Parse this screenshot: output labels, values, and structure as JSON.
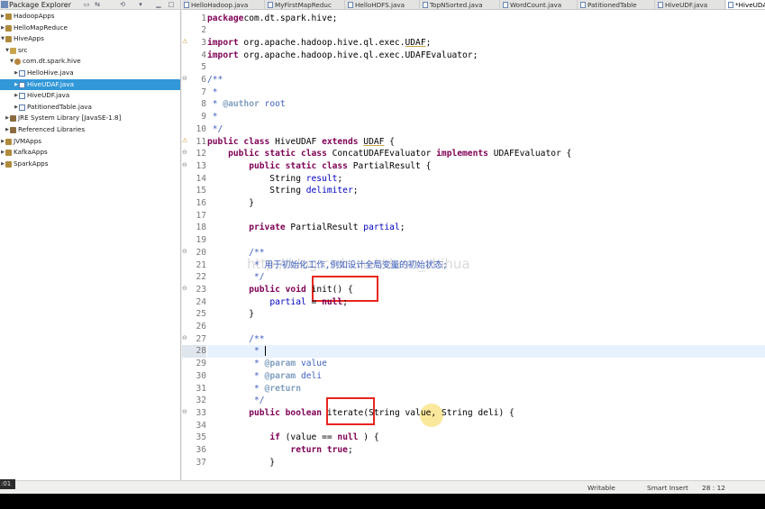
{
  "explorer": {
    "title": "Package Explorer",
    "toolbar_icons": [
      "minimize-icon",
      "maximize-icon",
      "view-menu-icon",
      "collapse-all-icon",
      "link-editor-icon"
    ],
    "items": [
      {
        "label": "HadoopApps",
        "level": 0,
        "expanded": false,
        "icon": "project"
      },
      {
        "label": "HelloMapReduce",
        "level": 0,
        "expanded": false,
        "icon": "project"
      },
      {
        "label": "HiveApps",
        "level": 0,
        "expanded": true,
        "icon": "project"
      },
      {
        "label": "src",
        "level": 1,
        "expanded": true,
        "icon": "folder"
      },
      {
        "label": "com.dt.spark.hive",
        "level": 2,
        "expanded": true,
        "icon": "package"
      },
      {
        "label": "HelloHive.java",
        "level": 3,
        "expanded": false,
        "icon": "java"
      },
      {
        "label": "HiveUDAF.java",
        "level": 3,
        "expanded": false,
        "icon": "java",
        "selected": true
      },
      {
        "label": "HiveUDF.java",
        "level": 3,
        "expanded": false,
        "icon": "java"
      },
      {
        "label": "PatitionedTable.java",
        "level": 3,
        "expanded": false,
        "icon": "java"
      },
      {
        "label": "JRE System Library [JavaSE-1.8]",
        "level": 1,
        "expanded": false,
        "icon": "lib"
      },
      {
        "label": "Referenced Libraries",
        "level": 1,
        "expanded": false,
        "icon": "lib"
      },
      {
        "label": "JVMApps",
        "level": 0,
        "expanded": false,
        "icon": "project"
      },
      {
        "label": "KafkaApps",
        "level": 0,
        "expanded": false,
        "icon": "project"
      },
      {
        "label": "SparkApps",
        "level": 0,
        "expanded": false,
        "icon": "project"
      }
    ]
  },
  "tabs": [
    {
      "label": "HelloHadoop.java"
    },
    {
      "label": "MyFirstMapReduc"
    },
    {
      "label": "HelloHDFS.java"
    },
    {
      "label": "TopNSorted.java"
    },
    {
      "label": "WordCount.java"
    },
    {
      "label": "PatitionedTable"
    },
    {
      "label": "HiveUDF.java"
    },
    {
      "label": "*HiveUDAF",
      "active": true
    }
  ],
  "code": {
    "current_line": 28,
    "lines": [
      {
        "n": "1",
        "t": [
          [
            "kw",
            "package"
          ],
          [
            "",
            "com.dt.spark.hive;"
          ]
        ]
      },
      {
        "n": "2",
        "t": []
      },
      {
        "n": "3",
        "marker": true,
        "t": [
          [
            "kw",
            "import"
          ],
          [
            "",
            " org.apache.hadoop.hive.ql.exec."
          ],
          [
            "ul",
            "UDAF"
          ],
          [
            "",
            ";"
          ]
        ]
      },
      {
        "n": "4",
        "t": [
          [
            "kw",
            "import"
          ],
          [
            "",
            " org.apache.hadoop.hive.ql.exec.UDAFEvaluator;"
          ]
        ]
      },
      {
        "n": "5",
        "t": []
      },
      {
        "n": "6",
        "fold": true,
        "t": [
          [
            "cm",
            "/**"
          ]
        ]
      },
      {
        "n": "7",
        "t": [
          [
            "cm",
            " *"
          ]
        ]
      },
      {
        "n": "8",
        "t": [
          [
            "cm",
            " * "
          ],
          [
            "cm-tag",
            "@author"
          ],
          [
            "cm",
            " root"
          ]
        ]
      },
      {
        "n": "9",
        "t": [
          [
            "cm",
            " *"
          ]
        ]
      },
      {
        "n": "10",
        "t": [
          [
            "cm",
            " */"
          ]
        ]
      },
      {
        "n": "11",
        "marker": true,
        "t": [
          [
            "kw",
            "public class"
          ],
          [
            "",
            " HiveUDAF "
          ],
          [
            "kw",
            "extends"
          ],
          [
            "",
            " "
          ],
          [
            "ul",
            "UDAF"
          ],
          [
            "",
            " {"
          ]
        ]
      },
      {
        "n": "12",
        "fold": true,
        "t": [
          [
            "",
            "    "
          ],
          [
            "kw",
            "public static class"
          ],
          [
            "",
            " ConcatUDAFEvaluator "
          ],
          [
            "kw",
            "implements"
          ],
          [
            "",
            " UDAFEvaluator {"
          ]
        ]
      },
      {
        "n": "13",
        "fold": true,
        "t": [
          [
            "",
            "        "
          ],
          [
            "kw",
            "public static class"
          ],
          [
            "",
            " PartialResult {"
          ]
        ]
      },
      {
        "n": "14",
        "t": [
          [
            "",
            "            String "
          ],
          [
            "fld",
            "result"
          ],
          [
            "",
            ";"
          ]
        ]
      },
      {
        "n": "15",
        "t": [
          [
            "",
            "            String "
          ],
          [
            "fld",
            "delimiter"
          ],
          [
            "",
            ";"
          ]
        ]
      },
      {
        "n": "16",
        "t": [
          [
            "",
            "        }"
          ]
        ]
      },
      {
        "n": "17",
        "t": []
      },
      {
        "n": "18",
        "t": [
          [
            "",
            "        "
          ],
          [
            "kw",
            "private"
          ],
          [
            "",
            " PartialResult "
          ],
          [
            "fld",
            "partial"
          ],
          [
            "",
            ";"
          ]
        ]
      },
      {
        "n": "19",
        "t": []
      },
      {
        "n": "20",
        "fold": true,
        "t": [
          [
            "cm",
            "        /**"
          ]
        ]
      },
      {
        "n": "21",
        "t": [
          [
            "cm",
            "         * 用于初始化工作,例如设计全局变量的初始状态;"
          ]
        ]
      },
      {
        "n": "22",
        "t": [
          [
            "cm",
            "         */"
          ]
        ]
      },
      {
        "n": "23",
        "fold": true,
        "t": [
          [
            "",
            "        "
          ],
          [
            "kw",
            "public void"
          ],
          [
            "",
            " init() {"
          ]
        ]
      },
      {
        "n": "24",
        "t": [
          [
            "",
            "            "
          ],
          [
            "fld",
            "partial"
          ],
          [
            "",
            " = "
          ],
          [
            "kw",
            "null"
          ],
          [
            "",
            ";"
          ]
        ]
      },
      {
        "n": "25",
        "t": [
          [
            "",
            "        }"
          ]
        ]
      },
      {
        "n": "26",
        "t": []
      },
      {
        "n": "27",
        "fold": true,
        "t": [
          [
            "cm",
            "        /**"
          ]
        ]
      },
      {
        "n": "28",
        "caret": true,
        "t": [
          [
            "cm",
            "         * "
          ]
        ]
      },
      {
        "n": "29",
        "t": [
          [
            "cm",
            "         * "
          ],
          [
            "cm-tag",
            "@param"
          ],
          [
            "cm",
            " value"
          ]
        ]
      },
      {
        "n": "30",
        "t": [
          [
            "cm",
            "         * "
          ],
          [
            "cm-tag",
            "@param"
          ],
          [
            "cm",
            " deli"
          ]
        ]
      },
      {
        "n": "31",
        "t": [
          [
            "cm",
            "         * "
          ],
          [
            "cm-tag",
            "@return"
          ]
        ]
      },
      {
        "n": "32",
        "t": [
          [
            "cm",
            "         */"
          ]
        ]
      },
      {
        "n": "33",
        "fold": true,
        "t": [
          [
            "",
            "        "
          ],
          [
            "kw",
            "public boolean"
          ],
          [
            "",
            " iterate(String value, String deli) {"
          ]
        ]
      },
      {
        "n": "34",
        "t": []
      },
      {
        "n": "35",
        "t": [
          [
            "",
            "            "
          ],
          [
            "kw",
            "if"
          ],
          [
            "",
            " (value == "
          ],
          [
            "kw",
            "null"
          ],
          [
            "",
            " ) {"
          ]
        ]
      },
      {
        "n": "36",
        "t": [
          [
            "",
            "                "
          ],
          [
            "kw",
            "return true"
          ],
          [
            "",
            ";"
          ]
        ]
      },
      {
        "n": "37",
        "t": [
          [
            "",
            "            }"
          ]
        ]
      }
    ]
  },
  "watermark": "http://blog.csdn.net/duan_zhihua",
  "status": {
    "writable": "Writable",
    "insert_mode": "Smart Insert",
    "position": "28 : 12"
  },
  "overlay": {
    "time": ":01"
  },
  "colors": {
    "selection": "#3298d8",
    "keyword": "#7f0055",
    "comment": "#3f5fbf",
    "field": "#0000c0",
    "highlight_box": "#e8261e"
  }
}
